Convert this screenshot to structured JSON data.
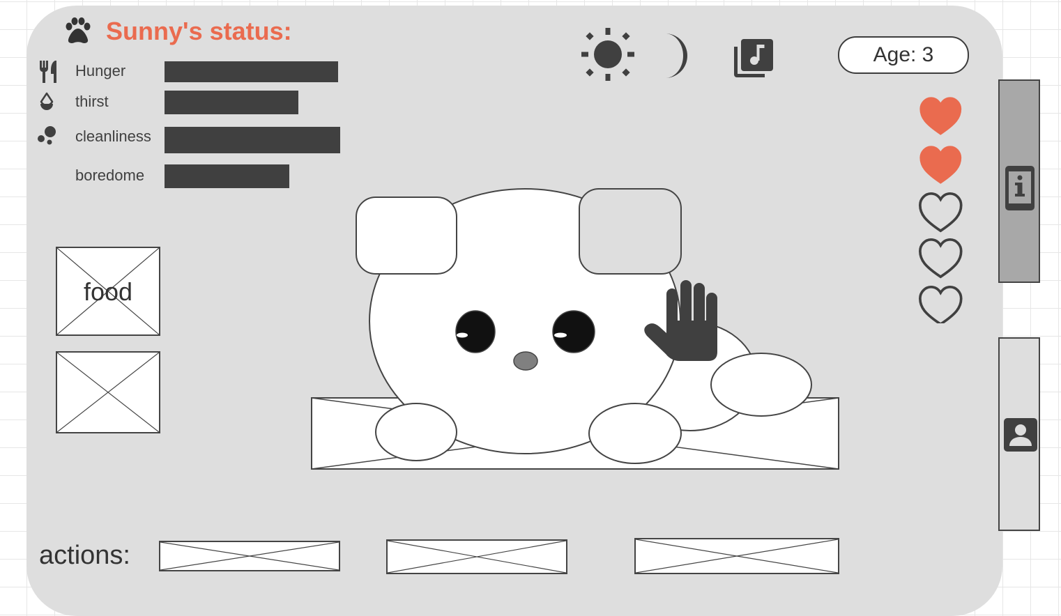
{
  "header": {
    "title": "Sunny's status:",
    "title_icon": "paw-icon",
    "title_color": "#ea6b4f"
  },
  "stats": [
    {
      "label": "Hunger",
      "icon": "utensils-icon",
      "level": 0.99
    },
    {
      "label": "thirst",
      "icon": "water-drop-icon",
      "level": 0.76
    },
    {
      "label": "cleanliness",
      "icon": "bubbles-icon",
      "level": 1.0
    },
    {
      "label": "boredome",
      "icon": "",
      "level": 0.71
    }
  ],
  "toolbar": {
    "icons": [
      "sun-icon",
      "moon-icon",
      "music-library-icon"
    ]
  },
  "age": {
    "label": "Age: 3"
  },
  "lives": {
    "filled": 2,
    "total": 5,
    "filled_color": "#ea6b4f"
  },
  "side_buttons": [
    "info-icon",
    "contact-icon"
  ],
  "items": [
    {
      "label": "food"
    },
    {
      "label": ""
    }
  ],
  "actions": {
    "label": "actions:",
    "slots": 3
  },
  "pet": {
    "name": "Sunny",
    "hand_icon": "hand-icon"
  },
  "colors": {
    "device_bg": "#dedede",
    "dark": "#404040",
    "accent": "#ea6b4f"
  }
}
